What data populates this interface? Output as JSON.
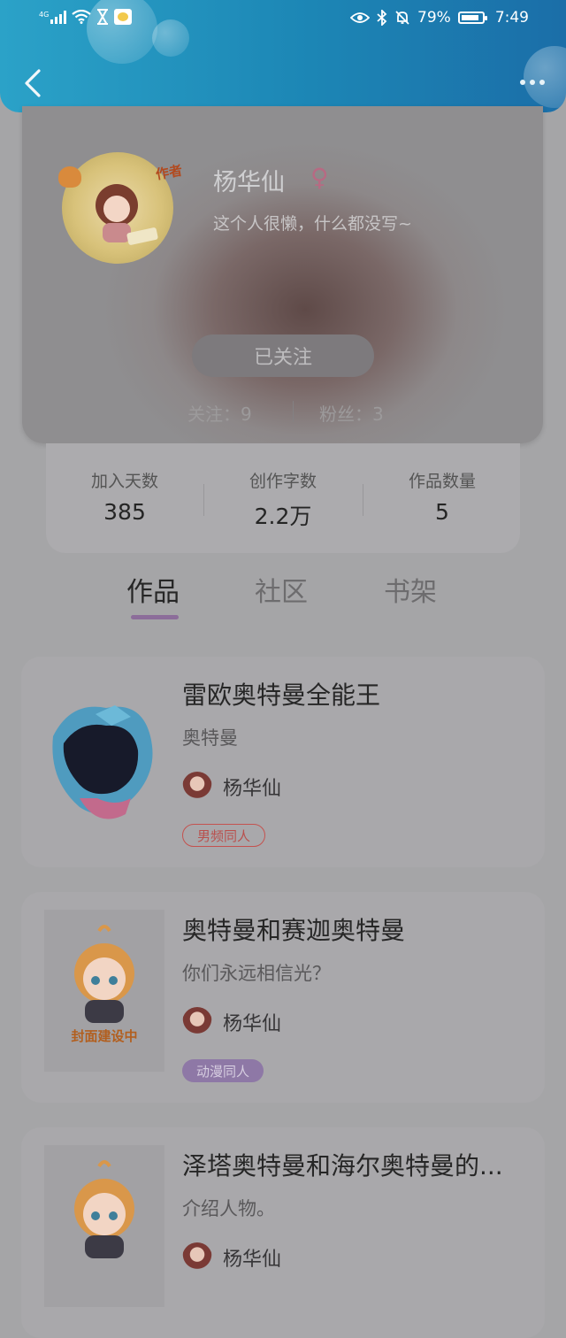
{
  "status_bar": {
    "network_type": "4G",
    "battery_percent": "79%",
    "time": "7:49",
    "icons": [
      "signal-icon",
      "wifi-icon",
      "hourglass-icon",
      "wechat-icon",
      "eye-icon",
      "bluetooth-icon",
      "mute-icon",
      "battery-icon"
    ]
  },
  "header": {
    "back_icon": "chevron-left-icon",
    "more_icon": "more-dots-icon"
  },
  "profile": {
    "avatar_badge": "作者",
    "name": "杨华仙",
    "gender_symbol": "♀",
    "bio": "这个人很懒，什么都没写~",
    "follow_button": "已关注",
    "following": "关注：9",
    "fans": "粉丝：3"
  },
  "stats": [
    {
      "label": "加入天数",
      "value": "385"
    },
    {
      "label": "创作字数",
      "value": "2.2万"
    },
    {
      "label": "作品数量",
      "value": "5"
    }
  ],
  "tabs": [
    {
      "label": "作品",
      "active": true
    },
    {
      "label": "社区",
      "active": false
    },
    {
      "label": "书架",
      "active": false
    }
  ],
  "works": [
    {
      "title": "雷欧奥特曼全能王",
      "subtitle": "奥特曼",
      "author": "杨华仙",
      "tag": "男频同人",
      "tag_color": "#c4524f",
      "cover": "bracelet-cover"
    },
    {
      "title": "奥特曼和赛迦奥特曼",
      "subtitle": "你们永远相信光？",
      "author": "杨华仙",
      "tag": "动漫同人",
      "tag_color": "#8e78a6",
      "cover": "placeholder-cover",
      "cover_text": "封面建设中"
    },
    {
      "title": "泽塔奥特曼和海尔奥特曼的...",
      "subtitle": "介绍人物。",
      "author": "杨华仙",
      "tag": "",
      "cover": "placeholder-cover"
    }
  ]
}
